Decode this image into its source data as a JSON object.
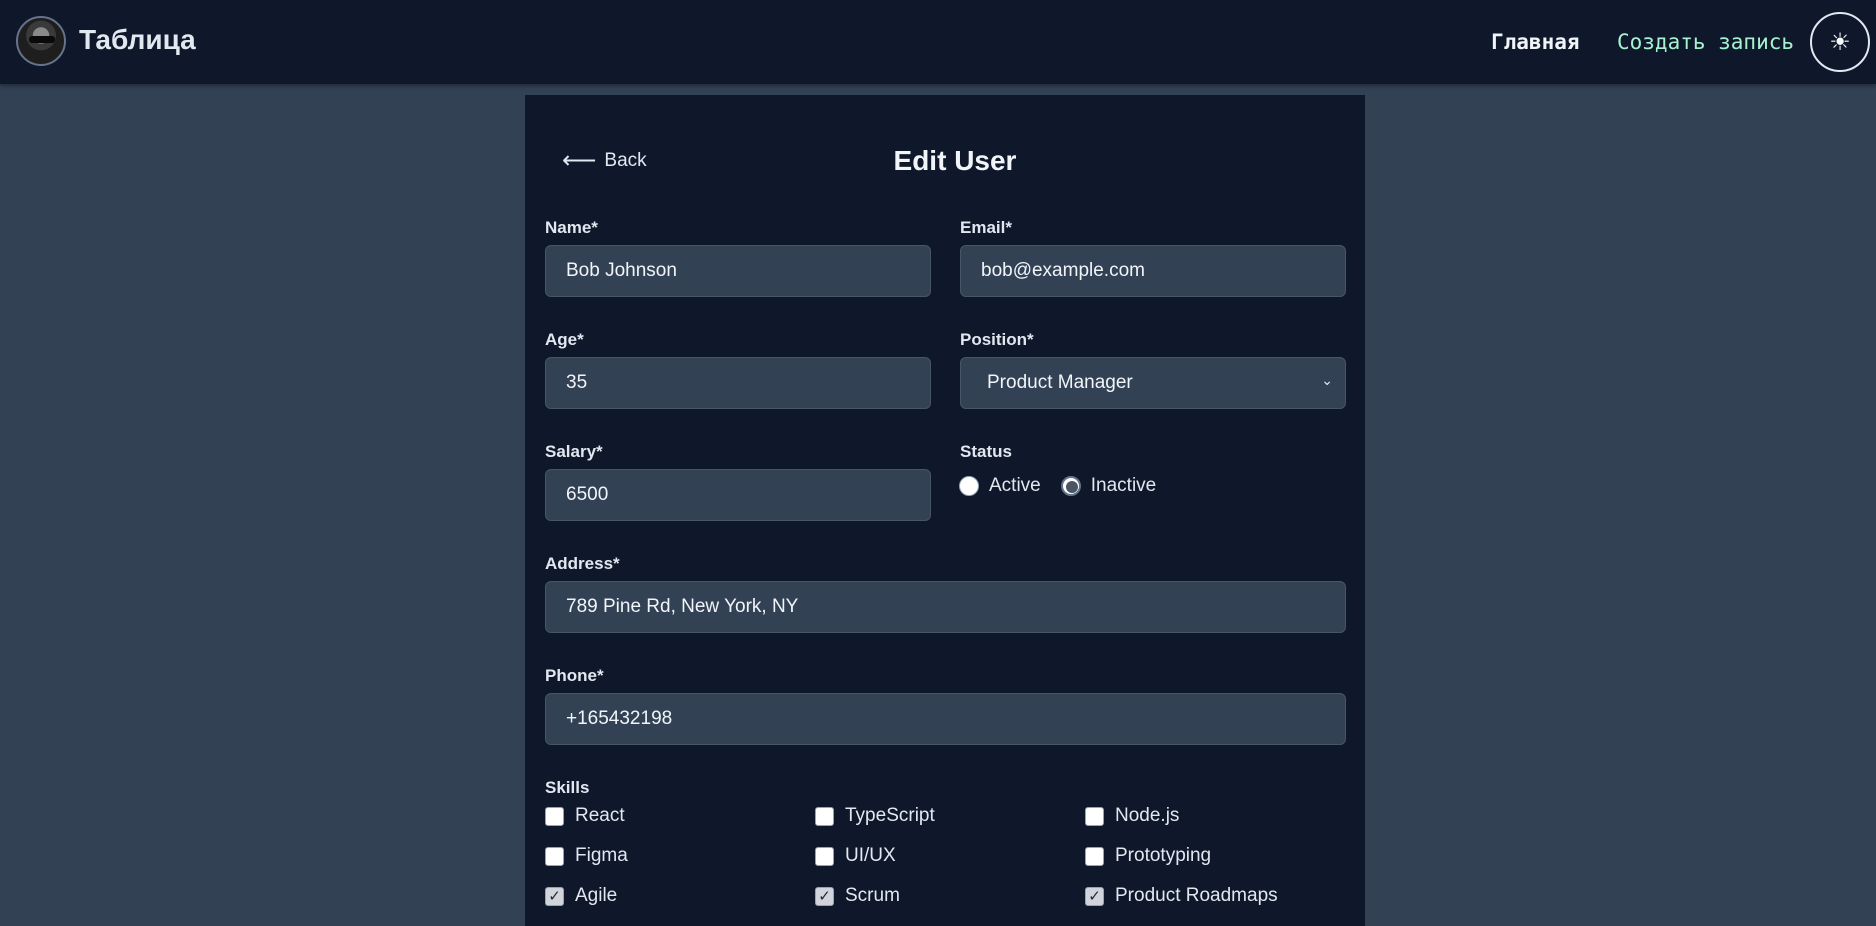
{
  "navbar": {
    "brand": "Таблица",
    "home": "Главная",
    "create": "Создать запись",
    "theme_icon": "☀"
  },
  "form": {
    "back": "Back",
    "back_icon": "⟵",
    "title": "Edit User",
    "name_label": "Name*",
    "name_value": "Bob Johnson",
    "email_label": "Email*",
    "email_value": "bob@example.com",
    "age_label": "Age*",
    "age_value": "35",
    "position_label": "Position*",
    "position_value": "Product Manager",
    "salary_label": "Salary*",
    "salary_value": "6500",
    "status_label": "Status",
    "status_options": [
      "Active",
      "Inactive"
    ],
    "status_selected": "Inactive",
    "address_label": "Address*",
    "address_value": "789 Pine Rd, New York, NY",
    "phone_label": "Phone*",
    "phone_value": "+165432198",
    "skills_label": "Skills",
    "skills": [
      {
        "label": "React",
        "checked": false
      },
      {
        "label": "TypeScript",
        "checked": false
      },
      {
        "label": "Node.js",
        "checked": false
      },
      {
        "label": "Figma",
        "checked": false
      },
      {
        "label": "UI/UX",
        "checked": false
      },
      {
        "label": "Prototyping",
        "checked": false
      },
      {
        "label": "Agile",
        "checked": true
      },
      {
        "label": "Scrum",
        "checked": true
      },
      {
        "label": "Product Roadmaps",
        "checked": true
      }
    ]
  }
}
